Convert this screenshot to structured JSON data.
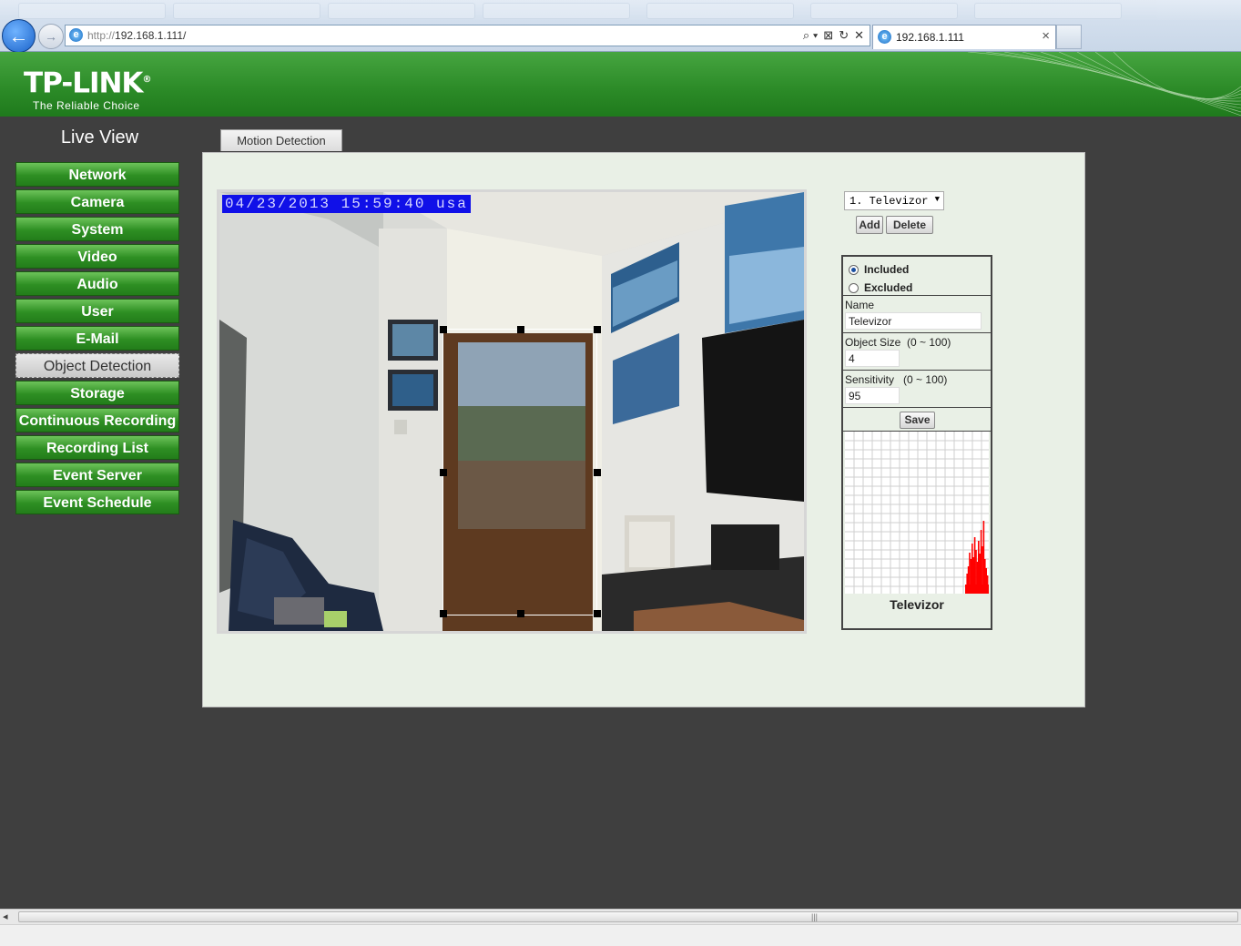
{
  "browser": {
    "url_scheme": "http://",
    "url_host": "192.168.1.111/",
    "tab_title": "192.168.1.111",
    "tab_close": "×",
    "back_glyph": "←",
    "forward_glyph": "→",
    "address_tools": [
      "⌕ ▾",
      "⊠",
      "↻",
      "✕"
    ]
  },
  "header": {
    "brand": "TP-LINK",
    "trademark": "®",
    "tagline": "The Reliable Choice"
  },
  "sidebar": {
    "title": "Live View",
    "items": [
      {
        "label": "Network",
        "active": false
      },
      {
        "label": "Camera",
        "active": false
      },
      {
        "label": "System",
        "active": false
      },
      {
        "label": "Video",
        "active": false
      },
      {
        "label": "Audio",
        "active": false
      },
      {
        "label": "User",
        "active": false
      },
      {
        "label": "E-Mail",
        "active": false
      },
      {
        "label": "Object Detection",
        "active": true
      },
      {
        "label": "Storage",
        "active": false
      },
      {
        "label": "Continuous Recording",
        "active": false
      },
      {
        "label": "Recording List",
        "active": false
      },
      {
        "label": "Event Server",
        "active": false
      },
      {
        "label": "Event Schedule",
        "active": false
      }
    ]
  },
  "content": {
    "tab_label": "Motion Detection",
    "video": {
      "osd_text": "04/23/2013 15:59:40 usa"
    },
    "zone_select": {
      "selected": "1. Televizor"
    },
    "add_label": "Add",
    "delete_label": "Delete",
    "settings": {
      "included_label": "Included",
      "excluded_label": "Excluded",
      "included_selected": true,
      "name_label": "Name",
      "name_value": "Televizor",
      "object_size_label": "Object Size",
      "object_size_range": "(0 ~ 100)",
      "object_size_value": "4",
      "sensitivity_label": "Sensitivity",
      "sensitivity_range": "(0 ~ 100)",
      "sensitivity_value": "95",
      "save_label": "Save"
    },
    "graph": {
      "caption": "Televizor",
      "grid_color": "#cfcfcf",
      "bar_color": "#ff0000"
    }
  },
  "scrollbar": {
    "left_arrow": "◂",
    "grip": "|||"
  }
}
